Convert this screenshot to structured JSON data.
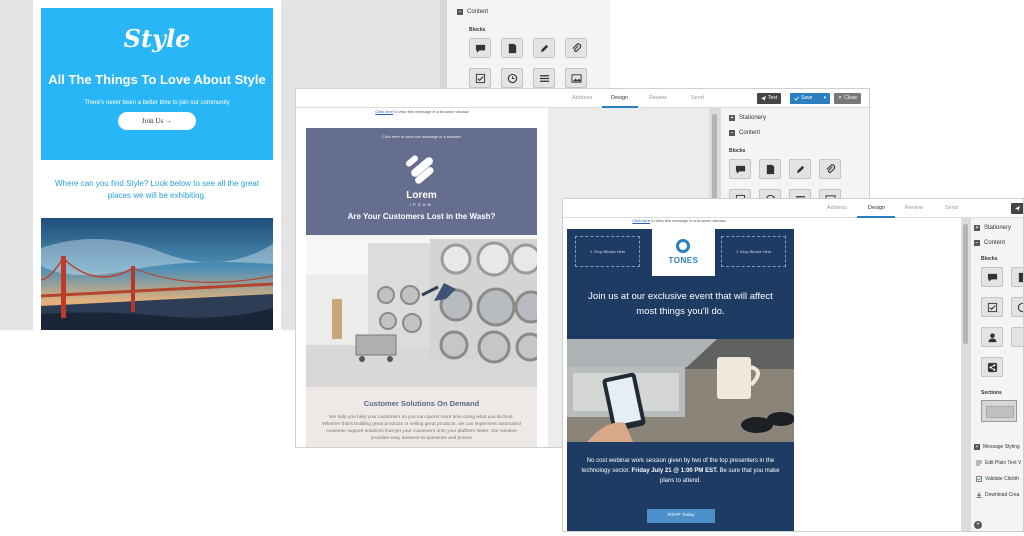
{
  "colors": {
    "style_blue": "#29b6f6",
    "lorem_slate": "#666e90",
    "tones_navy": "#1d3b63",
    "accent_blue": "#2a7fc0",
    "save_blue": "#2a7fc0",
    "dark_button": "#444444",
    "gray_button": "#777777"
  },
  "window1": {
    "logo": "Style",
    "headline": "All The Things To Love About Style",
    "subtext": "There's never been a better time to join our community",
    "button_label": "Join Us →",
    "body_text": "Where can you find Style? Look below to see all the great places we will be exhibiting.",
    "panel": {
      "content_label": "Content",
      "blocks_label": "Blocks"
    }
  },
  "window2": {
    "tabs": [
      "Address",
      "Design",
      "Review",
      "Send"
    ],
    "active_tab": "Design",
    "toolbar": {
      "test": "Test",
      "save": "Save",
      "close": "Close"
    },
    "browser_link_prefix": "Click here",
    "browser_link_suffix": " to view this message in a browser window",
    "hero_link": "Click here to view this message in a browser",
    "brand": "Lorem",
    "brand_sub": "IPSUM",
    "headline": "Are Your Customers Lost in the Wash?",
    "section_title": "Customer Solutions On Demand",
    "section_body": "We help you help your customers so you can spend more time doing what you do best. Whether that's building great products or selling great products, we can implement automated customer support solutions that get your customers onto your platform faster. Our solution provides easy answers to questions and proven",
    "panel": {
      "stationery_label": "Stationery",
      "content_label": "Content",
      "blocks_label": "Blocks"
    }
  },
  "window3": {
    "tabs": [
      "Address",
      "Design",
      "Review",
      "Send"
    ],
    "active_tab": "Design",
    "browser_link_prefix": "Click here",
    "browser_link_suffix": " to view this message in a browser window",
    "drop_left": "⇩ Drop Blocks Here",
    "drop_right": "⇩ Drop Blocks Here",
    "logo": "TONES",
    "headline": "Join us at our exclusive event that will affect most things you'll do.",
    "body_plain": "No cost webinar work session given by two of the top presenters in the technology sector.",
    "body_bold": "Friday July 21 @ 1:00 PM EST.",
    "body_end": "Be sure that you make plans to attend.",
    "rsvp": "RSVP Today",
    "panel": {
      "stationery_label": "Stationery",
      "content_label": "Content",
      "blocks_label": "Blocks",
      "sections_label": "Sections",
      "menu": [
        "Message Styling",
        "Edit Plain Text V",
        "Validate Clickth",
        "Download Crea"
      ]
    }
  }
}
